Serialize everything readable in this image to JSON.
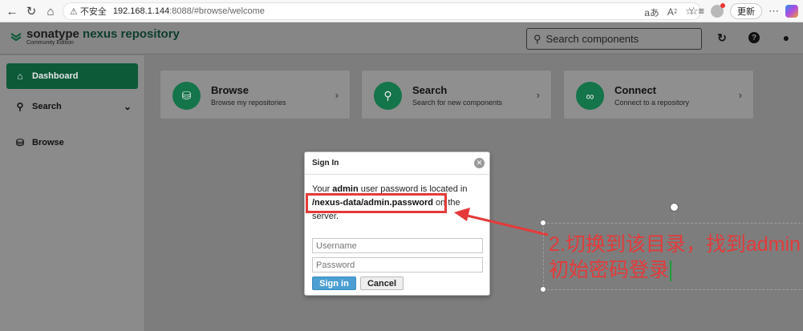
{
  "browser": {
    "warning_label": "不安全",
    "url_host": "192.168.1.144",
    "url_rest": ":8088/#browse/welcome",
    "update_label": "更新",
    "reader_icon": "aあ"
  },
  "header": {
    "brand_prefix": "sonatype ",
    "brand_name": "nexus repository",
    "edition": "Community Edition",
    "search_placeholder": "Search components"
  },
  "sidebar": {
    "items": [
      {
        "label": "Dashboard",
        "icon": "home-icon",
        "active": true
      },
      {
        "label": "Search",
        "icon": "search-icon",
        "active": false
      },
      {
        "label": "Browse",
        "icon": "database-icon",
        "active": false
      }
    ]
  },
  "cards": [
    {
      "title": "Browse",
      "description": "Browse my repositories",
      "icon": "database-icon"
    },
    {
      "title": "Search",
      "description": "Search for new components",
      "icon": "search-icon"
    },
    {
      "title": "Connect",
      "description": "Connect to a repository",
      "icon": "link-icon"
    }
  ],
  "signin": {
    "title": "Sign In",
    "msg_1": "Your ",
    "msg_admin": "admin",
    "msg_2": " user password is located in ",
    "msg_path": "/nexus-data/admin.password",
    "msg_3": " on the server.",
    "username_placeholder": "Username",
    "password_placeholder": "Password",
    "signin_label": "Sign in",
    "cancel_label": "Cancel"
  },
  "annotation": {
    "line1": "2.切换到该目录，找到admin",
    "line2": "初始密码登录"
  },
  "colors": {
    "brand_green": "#0d5a38",
    "circle_green": "#14744a",
    "annotation_red": "#e43a3a",
    "signin_blue": "#4b9fd2"
  }
}
